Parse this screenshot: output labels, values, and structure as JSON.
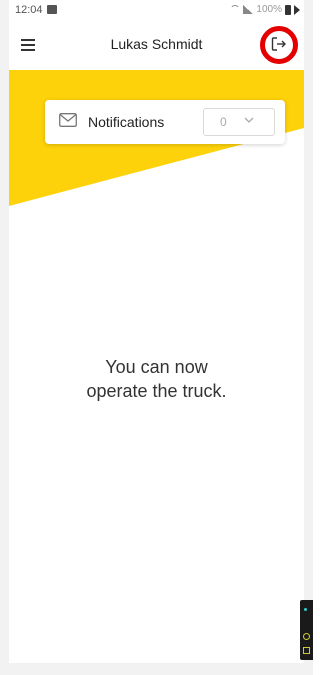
{
  "status_bar": {
    "time": "12:04",
    "battery": "100%"
  },
  "app_bar": {
    "menu_icon": "menu-icon",
    "title": "Lukas Schmidt",
    "logout_icon": "logout-icon"
  },
  "notifications": {
    "icon": "mail-icon",
    "label": "Notifications",
    "selected_value": "0"
  },
  "message": {
    "line1": "You can now",
    "line2": "operate the truck."
  },
  "colors": {
    "accent": "#fdd20a",
    "highlight_ring": "#e40000"
  }
}
